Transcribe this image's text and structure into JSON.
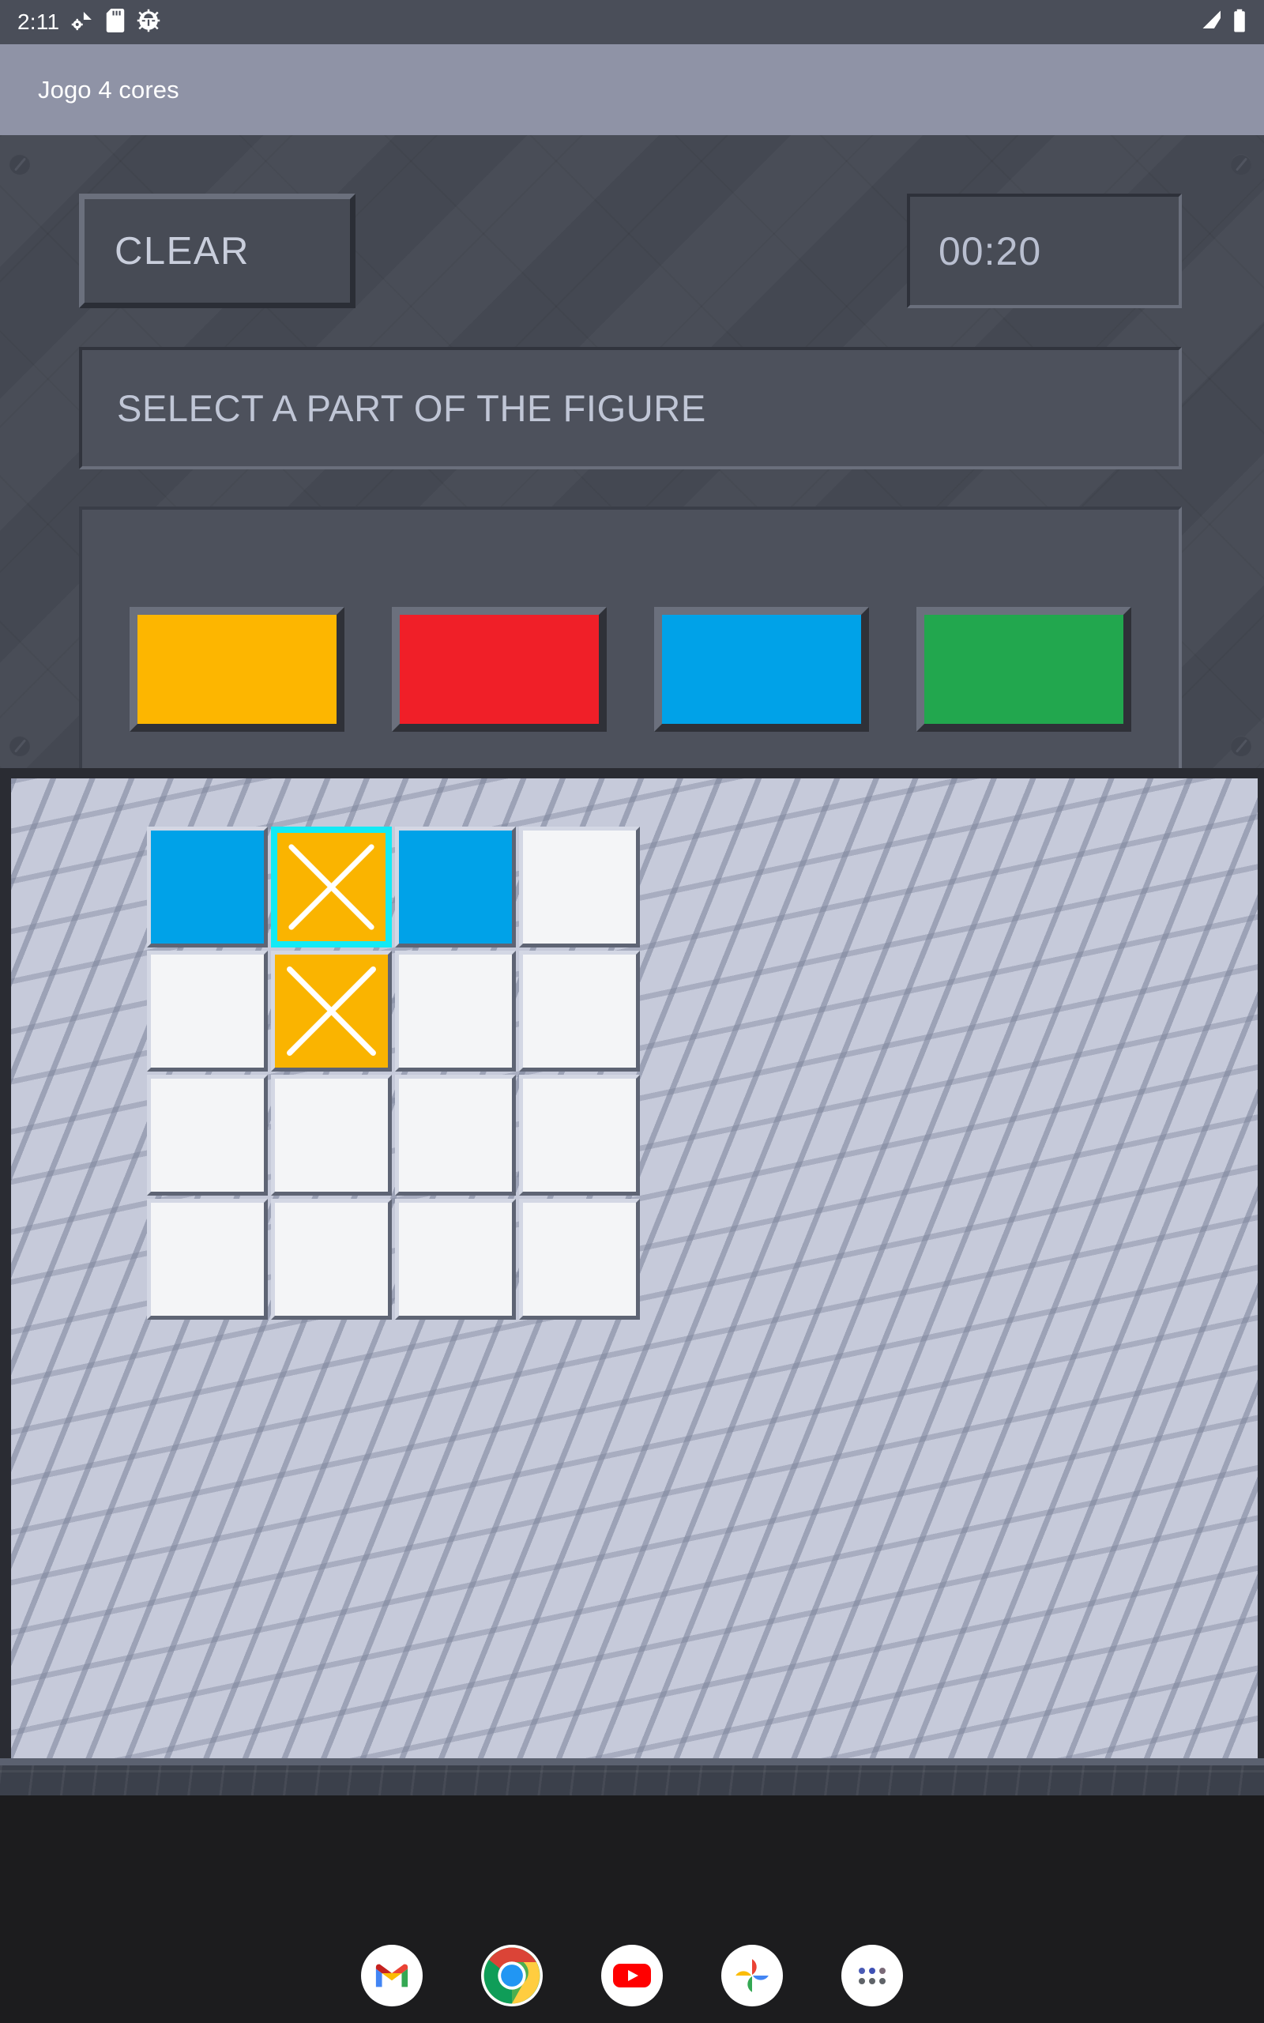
{
  "status_bar": {
    "time": "2:11",
    "icons": [
      "bluetooth-wifi-icon",
      "sd-card-icon",
      "android-debug-icon"
    ],
    "right_icons": [
      "signal-icon",
      "battery-icon"
    ]
  },
  "app_bar": {
    "title": "Jogo 4 cores"
  },
  "control_panel": {
    "clear_label": "CLEAR",
    "timer": "00:20",
    "message": "SELECT A PART OF THE FIGURE",
    "palette": [
      {
        "name": "yellow",
        "color": "#FDB600"
      },
      {
        "name": "red",
        "color": "#F01F28"
      },
      {
        "name": "blue",
        "color": "#00A2E8"
      },
      {
        "name": "green",
        "color": "#22A74E"
      }
    ]
  },
  "board": {
    "rows": 4,
    "cols": 4,
    "empty_color": "#F4F5F7",
    "selected_outline_color": "#12EAF5",
    "cells": [
      {
        "row": 0,
        "col": 0,
        "color": "#00A2E8",
        "marked": false,
        "selected": false
      },
      {
        "row": 0,
        "col": 1,
        "color": "#FAB400",
        "marked": true,
        "selected": true
      },
      {
        "row": 0,
        "col": 2,
        "color": "#00A2E8",
        "marked": false,
        "selected": false
      },
      {
        "row": 0,
        "col": 3,
        "color": "#F4F5F7",
        "marked": false,
        "selected": false
      },
      {
        "row": 1,
        "col": 0,
        "color": "#F4F5F7",
        "marked": false,
        "selected": false
      },
      {
        "row": 1,
        "col": 1,
        "color": "#FAB400",
        "marked": true,
        "selected": false
      },
      {
        "row": 1,
        "col": 2,
        "color": "#F4F5F7",
        "marked": false,
        "selected": false
      },
      {
        "row": 1,
        "col": 3,
        "color": "#F4F5F7",
        "marked": false,
        "selected": false
      },
      {
        "row": 2,
        "col": 0,
        "color": "#F4F5F7",
        "marked": false,
        "selected": false
      },
      {
        "row": 2,
        "col": 1,
        "color": "#F4F5F7",
        "marked": false,
        "selected": false
      },
      {
        "row": 2,
        "col": 2,
        "color": "#F4F5F7",
        "marked": false,
        "selected": false
      },
      {
        "row": 2,
        "col": 3,
        "color": "#F4F5F7",
        "marked": false,
        "selected": false
      },
      {
        "row": 3,
        "col": 0,
        "color": "#F4F5F7",
        "marked": false,
        "selected": false
      },
      {
        "row": 3,
        "col": 1,
        "color": "#F4F5F7",
        "marked": false,
        "selected": false
      },
      {
        "row": 3,
        "col": 2,
        "color": "#F4F5F7",
        "marked": false,
        "selected": false
      },
      {
        "row": 3,
        "col": 3,
        "color": "#F4F5F7",
        "marked": false,
        "selected": false
      }
    ]
  },
  "dock": {
    "items": [
      {
        "name": "gmail-icon",
        "label": "Gmail"
      },
      {
        "name": "chrome-icon",
        "label": "Chrome"
      },
      {
        "name": "youtube-icon",
        "label": "YouTube"
      },
      {
        "name": "photos-icon",
        "label": "Photos"
      },
      {
        "name": "app-drawer-icon",
        "label": "All apps"
      }
    ]
  }
}
